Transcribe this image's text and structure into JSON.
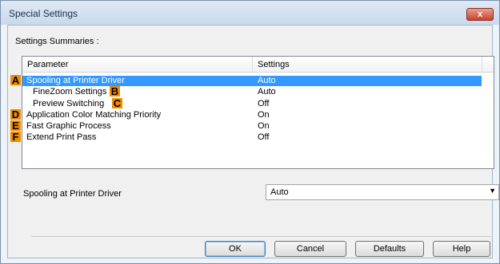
{
  "window": {
    "title": "Special Settings",
    "close_glyph": "x"
  },
  "summaries_label": "Settings Summaries :",
  "list": {
    "columns": [
      "Parameter",
      "Settings"
    ],
    "rows": [
      {
        "marker": "A",
        "parameter": "Spooling at Printer Driver",
        "setting": "Auto",
        "selected": true
      },
      {
        "marker": "B",
        "parameter": "FineZoom Settings",
        "setting": "Auto",
        "selected": false
      },
      {
        "marker": "C",
        "parameter": "Preview Switching",
        "setting": "Off",
        "selected": false
      },
      {
        "marker": "D",
        "parameter": "Application Color Matching Priority",
        "setting": "On",
        "selected": false
      },
      {
        "marker": "E",
        "parameter": "Fast Graphic Process",
        "setting": "On",
        "selected": false
      },
      {
        "marker": "F",
        "parameter": "Extend Print Pass",
        "setting": "Off",
        "selected": false
      }
    ]
  },
  "detail": {
    "label": "Spooling at Printer Driver",
    "value": "Auto"
  },
  "buttons": {
    "ok": "OK",
    "cancel": "Cancel",
    "defaults": "Defaults",
    "help": "Help"
  },
  "colors": {
    "selection": "#3399ff",
    "marker": "#f08c00"
  }
}
